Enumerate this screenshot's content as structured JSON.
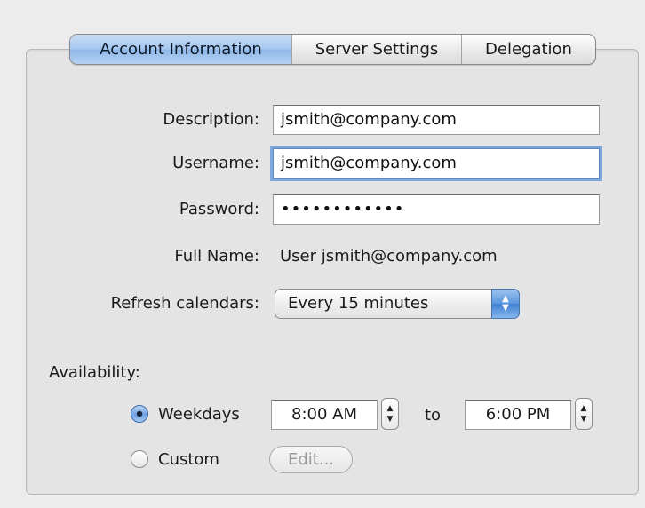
{
  "tabs": [
    {
      "label": "Account Information",
      "active": true
    },
    {
      "label": "Server Settings",
      "active": false
    },
    {
      "label": "Delegation",
      "active": false
    }
  ],
  "form": {
    "description_label": "Description:",
    "description_value": "jsmith@company.com",
    "username_label": "Username:",
    "username_value": "jsmith@company.com",
    "password_label": "Password:",
    "password_value": "••••••••••••",
    "fullname_label": "Full Name:",
    "fullname_value": "User jsmith@company.com",
    "refresh_label": "Refresh calendars:",
    "refresh_value": "Every 15 minutes"
  },
  "availability": {
    "label": "Availability:",
    "weekdays_label": "Weekdays",
    "weekdays_selected": true,
    "start_time": "8:00 AM",
    "to_label": "to",
    "end_time": "6:00 PM",
    "custom_label": "Custom",
    "edit_button": "Edit..."
  },
  "icons": {
    "popup_arrows": "▲▼",
    "stepper_arrows": "▲▼"
  },
  "colors": {
    "accent": "#6fa2e4",
    "focus_ring": "#7fa9dc",
    "background": "#ececec"
  }
}
